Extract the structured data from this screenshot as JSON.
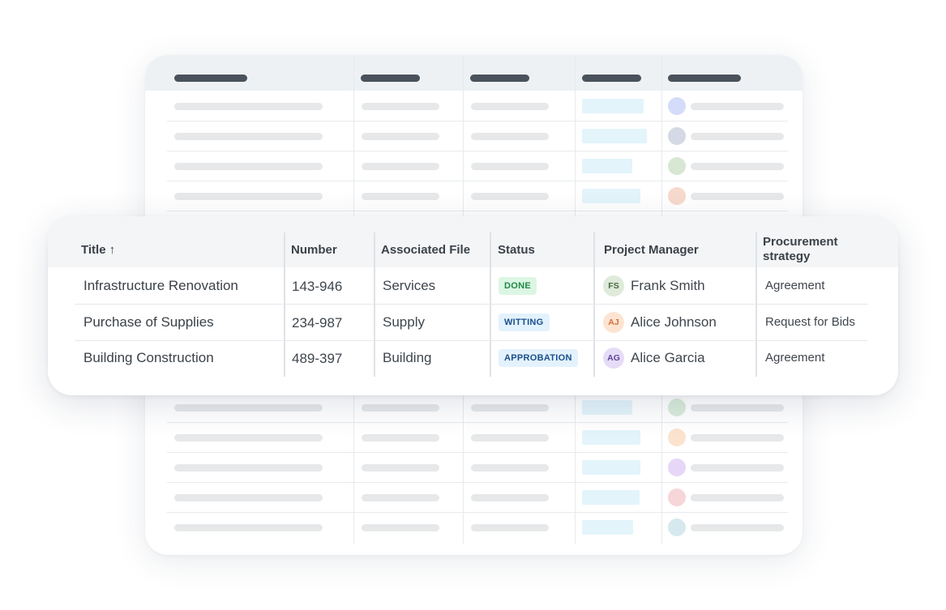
{
  "table": {
    "headers": {
      "title": "Title",
      "title_sort": "↑",
      "number": "Number",
      "file": "Associated File",
      "status": "Status",
      "manager": "Project Manager",
      "strategy_line1": "Procurement",
      "strategy_line2": "strategy"
    },
    "sort_icon": "arrow-up-icon",
    "rows": [
      {
        "title": "Infrastructure Renovation",
        "number": "143-946",
        "file": "Services",
        "status": "DONE",
        "status_bg": "#dcf6e4",
        "status_color": "#1f8a47",
        "avatar_initials": "FS",
        "avatar_bg": "#dfeadb",
        "avatar_color": "#47683d",
        "manager": "Frank Smith",
        "strategy": "Agreement"
      },
      {
        "title": "Purchase of Supplies",
        "number": "234-987",
        "file": "Supply",
        "status": "WITTING",
        "status_bg": "#e3f2fd",
        "status_color": "#1a4f8b",
        "avatar_initials": "AJ",
        "avatar_bg": "#fde4d2",
        "avatar_color": "#d2703a",
        "manager": "Alice Johnson",
        "strategy": "Request for Bids"
      },
      {
        "title": "Building Construction",
        "number": "489-397",
        "file": "Building",
        "status": "APPROBATION",
        "status_bg": "#e3f2fd",
        "status_color": "#1a4f8b",
        "avatar_initials": "AG",
        "avatar_bg": "#e6dcf7",
        "avatar_color": "#5e4598",
        "manager": "Alice Garcia",
        "strategy": "Agreement"
      }
    ]
  },
  "skeleton": {
    "chip_color": "#e3f4fb",
    "avatar_colors_top": [
      "#d5dcf9",
      "#d5d9e5",
      "#d8e6d4",
      "#f7d9cd"
    ],
    "avatar_colors_bottom": [
      "#d9ecdb",
      "#fbe3cd",
      "#e6d7f6",
      "#f6d6d8",
      "#d6e9ee"
    ]
  }
}
